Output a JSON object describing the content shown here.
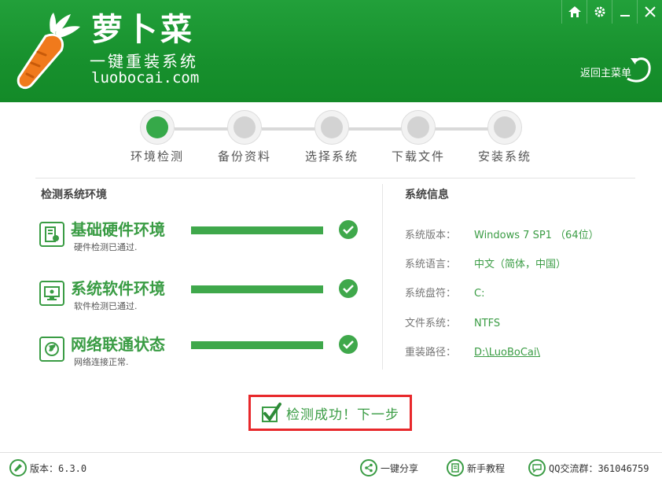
{
  "header": {
    "brand_name": "萝卜菜",
    "slogan": "一键重装系统",
    "url": "luobocai.com",
    "back_main_label": "返回主菜单",
    "window_controls": [
      "home-icon",
      "gear-icon",
      "minimize-icon",
      "close-icon"
    ]
  },
  "steps": [
    {
      "label": "环境检测",
      "active": true
    },
    {
      "label": "备份资料",
      "active": false
    },
    {
      "label": "选择系统",
      "active": false
    },
    {
      "label": "下载文件",
      "active": false
    },
    {
      "label": "安装系统",
      "active": false
    }
  ],
  "checks": {
    "title": "检测系统环境",
    "items": [
      {
        "title": "基础硬件环境",
        "sub": "硬件检测已通过.",
        "progress": 1.0,
        "icon": "hardware-icon"
      },
      {
        "title": "系统软件环境",
        "sub": "软件检测已通过.",
        "progress": 1.0,
        "icon": "software-icon"
      },
      {
        "title": "网络联通状态",
        "sub": "网络连接正常.",
        "progress": 1.0,
        "icon": "network-globe-icon"
      }
    ]
  },
  "sysinfo": {
    "title": "系统信息",
    "rows": [
      {
        "label": "系统版本：",
        "value": "Windows 7 SP1 （64位）"
      },
      {
        "label": "系统语言：",
        "value": "中文（简体，中国）"
      },
      {
        "label": "系统盘符：",
        "value": "C:"
      },
      {
        "label": "文件系统：",
        "value": "NTFS"
      },
      {
        "label": "重装路径：",
        "value": "D:\\LuoBoCai\\"
      }
    ]
  },
  "next_button": {
    "label": "检测成功！下一步"
  },
  "footer": {
    "version": "版本：6.3.0",
    "share": "一键分享",
    "tutorial": "新手教程",
    "qq_group": "QQ交流群：361046759"
  },
  "colors": {
    "brand_green": "#22a03a",
    "accent_green": "#3a9c44",
    "highlight_red": "#e8282b"
  }
}
